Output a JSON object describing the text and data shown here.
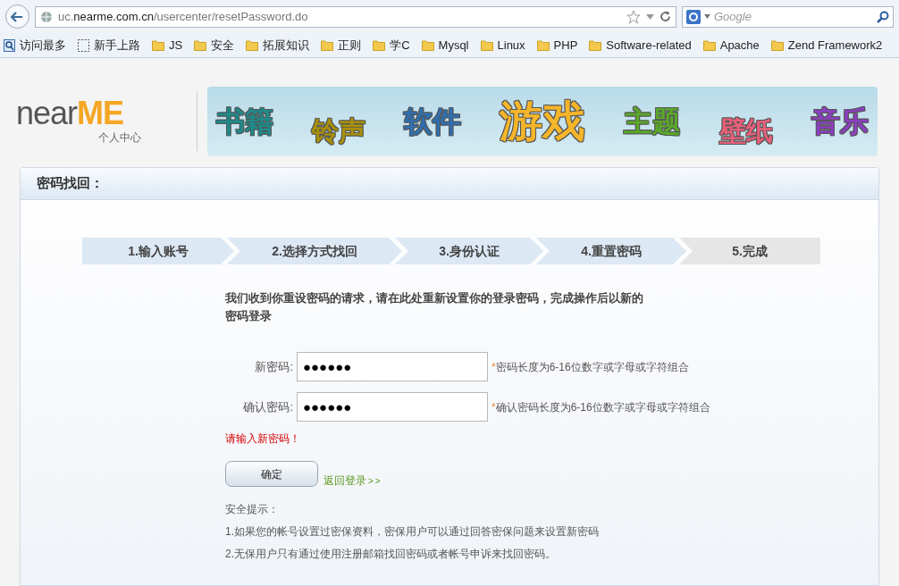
{
  "browser": {
    "url": "uc.**nearme.com.cn**/usercenter/resetPassword.do",
    "search_placeholder": "Google"
  },
  "bookmarks": [
    {
      "label": "访问最多",
      "kind": "smart"
    },
    {
      "label": "新手上路",
      "kind": "page"
    },
    {
      "label": "JS",
      "kind": "folder"
    },
    {
      "label": "安全",
      "kind": "folder"
    },
    {
      "label": "拓展知识",
      "kind": "folder"
    },
    {
      "label": "正则",
      "kind": "folder"
    },
    {
      "label": "学C",
      "kind": "folder"
    },
    {
      "label": "Mysql",
      "kind": "folder"
    },
    {
      "label": "Linux",
      "kind": "folder"
    },
    {
      "label": "PHP",
      "kind": "folder"
    },
    {
      "label": "Software-related",
      "kind": "folder"
    },
    {
      "label": "Apache",
      "kind": "folder"
    },
    {
      "label": "Zend Framework2",
      "kind": "folder"
    }
  ],
  "logo": {
    "word": "near",
    "accent": "ME",
    "subtitle": "个人中心"
  },
  "banner": [
    {
      "label": "书籍",
      "color": "#1f8a8a"
    },
    {
      "label": "铃声",
      "color": "#a8900a"
    },
    {
      "label": "软件",
      "color": "#2f6fae"
    },
    {
      "label": "游戏",
      "color": "#f5b52a"
    },
    {
      "label": "主题",
      "color": "#5aa82a"
    },
    {
      "label": "壁纸",
      "color": "#e8607a"
    },
    {
      "label": "音乐",
      "color": "#8a3fbf"
    }
  ],
  "panel": {
    "title": "密码找回："
  },
  "steps": [
    {
      "label": "1.输入账号",
      "done": true
    },
    {
      "label": "2.选择方式找回",
      "done": true
    },
    {
      "label": "3.身份认证",
      "done": true
    },
    {
      "label": "4.重置密码",
      "done": true
    },
    {
      "label": "5.完成",
      "done": false
    }
  ],
  "message": "我们收到你重设密码的请求，请在此处重新设置你的登录密码，完成操作后以新的密码登录",
  "fields": [
    {
      "label": "新密码:",
      "value": "●●●●●●",
      "required": "*",
      "hint": "密码长度为6-16位数字或字母或字符组合"
    },
    {
      "label": "确认密码:",
      "value": "●●●●●●",
      "required": "*",
      "hint": "确认密码长度为6-16位数字或字母或字符组合"
    }
  ],
  "error": "请输入新密码！",
  "submit": "确定",
  "back_link": "返回登录",
  "back_arrows": ">>",
  "tips_title": "安全提示：",
  "tips": [
    "1.如果您的帐号设置过密保资料，密保用户可以通过回答密保问题来设置新密码",
    "2.无保用户只有通过使用注册邮箱找回密码或者帐号申诉来找回密码。"
  ]
}
